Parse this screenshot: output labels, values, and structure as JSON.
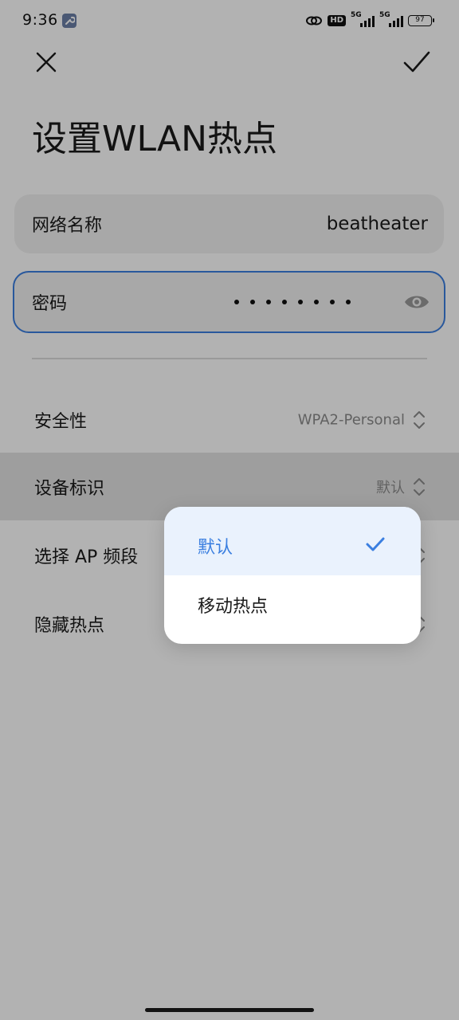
{
  "status_bar": {
    "time": "9:36",
    "hd_label": "HD",
    "signal_label_1": "5G",
    "signal_label_2": "5G",
    "battery": "97"
  },
  "header": {
    "title": "设置WLAN热点",
    "close_icon": "close-icon",
    "confirm_icon": "check-icon"
  },
  "network_name": {
    "label": "网络名称",
    "value": "beatheater"
  },
  "password": {
    "label": "密码",
    "masked_length": 8,
    "icon": "eye-icon"
  },
  "settings": [
    {
      "label": "安全性",
      "value": "WPA2-Personal"
    },
    {
      "label": "设备标识",
      "value": "默认"
    },
    {
      "label": "选择 AP 频段",
      "value": ""
    },
    {
      "label": "隐藏热点",
      "value": ""
    }
  ],
  "popup": {
    "options": [
      {
        "label": "默认",
        "selected": true
      },
      {
        "label": "移动热点",
        "selected": false
      }
    ]
  },
  "colors": {
    "accent": "#3b7fe0",
    "card_bg": "#f1f1f1",
    "selected_bg": "#eaf2fd",
    "overlay": "rgba(0,0,0,0.30)"
  }
}
